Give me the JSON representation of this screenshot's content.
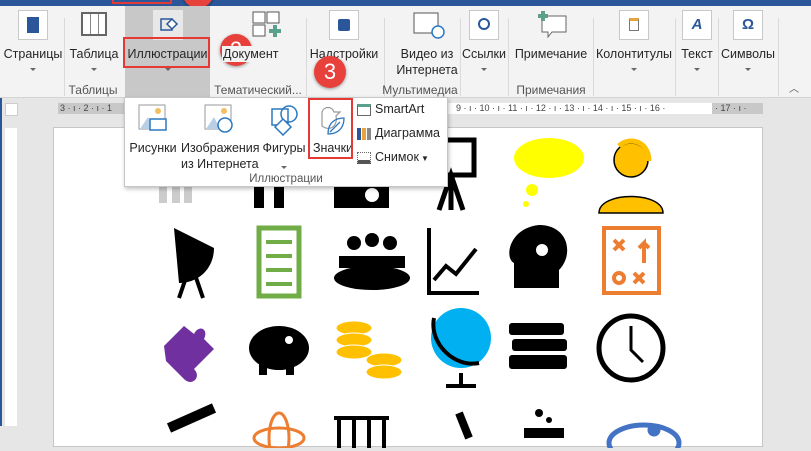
{
  "ribbon": {
    "buttons": [
      {
        "label": "Страницы"
      },
      {
        "label": "Таблица"
      },
      {
        "label": "Иллюстрации"
      },
      {
        "label": "Документ",
        "visible": "умент"
      },
      {
        "label": "Надстройки"
      },
      {
        "label": "Видео из",
        "label2": "Интернета"
      },
      {
        "label": "Ссылки"
      },
      {
        "label": "Примечание"
      },
      {
        "label": "Колонтитулы"
      },
      {
        "label": "Текст"
      },
      {
        "label": "Символы"
      }
    ],
    "groups": [
      "Таблицы",
      "Тематический...",
      "Мультимедиа",
      "Примечания"
    ]
  },
  "ruler": {
    "left": "3 · ı · 2 · ı · 1",
    "right": "9 · ı · 10 · ı · 11 · ı · 12 · ı · 13 · ı · 14 · ı · 15 · ı · 16 ·",
    "grey": "· 17 · ı ·"
  },
  "popup": {
    "items": [
      {
        "label": "Рисунки"
      },
      {
        "label": "Изображения",
        "label2": "из Интернета"
      },
      {
        "label": "Фигуры"
      },
      {
        "label": "Значки"
      }
    ],
    "side": [
      {
        "label": "SmartArt"
      },
      {
        "label": "Диаграмма"
      },
      {
        "label": "Снимок"
      }
    ],
    "group_label": "Иллюстрации"
  },
  "callouts": {
    "two": "2",
    "three": "3"
  },
  "icons": [
    "people",
    "people",
    "projector",
    "presentation",
    "thought-cloud",
    "support-agent",
    "satellite-dish",
    "checklist",
    "meeting",
    "growth-chart",
    "head-gears",
    "playbook",
    "puzzle",
    "piggy-bank",
    "coins",
    "globe",
    "books",
    "clock",
    "telescope",
    "atom",
    "lab-rack",
    "microscope",
    "flask",
    "palette"
  ],
  "colors": {
    "accent": "#2b579a",
    "callout": "#e8413c",
    "yellow": "#ffc000",
    "green": "#70ad47",
    "orange": "#ed7d31",
    "purple": "#7030a0",
    "blue": "#00b0f0"
  }
}
